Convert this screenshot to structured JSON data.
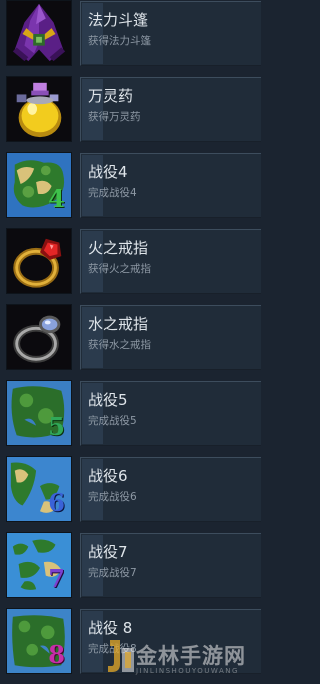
{
  "achievements": [
    {
      "title": "法力斗篷",
      "description": "获得法力斗篷",
      "icon": "cloak-icon"
    },
    {
      "title": "万灵药",
      "description": "获得万灵药",
      "icon": "potion-icon"
    },
    {
      "title": "战役4",
      "description": "完成战役4",
      "icon": "campaign-map-icon",
      "map_number": "4"
    },
    {
      "title": "火之戒指",
      "description": "获得火之戒指",
      "icon": "fire-ring-icon"
    },
    {
      "title": "水之戒指",
      "description": "获得水之戒指",
      "icon": "water-ring-icon"
    },
    {
      "title": "战役5",
      "description": "完成战役5",
      "icon": "campaign-map-icon",
      "map_number": "5"
    },
    {
      "title": "战役6",
      "description": "完成战役6",
      "icon": "campaign-map-icon",
      "map_number": "6"
    },
    {
      "title": "战役7",
      "description": "完成战役7",
      "icon": "campaign-map-icon",
      "map_number": "7"
    },
    {
      "title": "战役 8",
      "description": "完成战役8",
      "icon": "campaign-map-icon",
      "map_number": "8"
    }
  ],
  "watermark": {
    "text": "金林手游网",
    "subtext": "JINLINSHOUYOUWANG"
  },
  "colors": {
    "background": "#1b2430",
    "panel": "#202c39",
    "progress_bar": "#2b3b4d",
    "title_text": "#dfe5ea",
    "desc_text": "#8d98a4"
  }
}
